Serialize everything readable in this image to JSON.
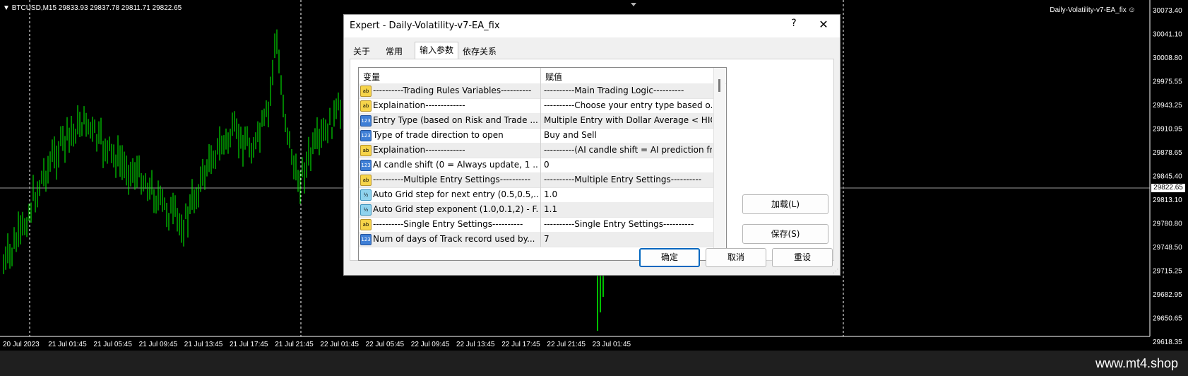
{
  "chart": {
    "symbol_info": "BTCUSD,M15  29833.93 29837.78 29811.71 29822.65",
    "ea_name": "Daily-Volatility-v7-EA_fix",
    "smile_glyph": "☺",
    "current_price": "29822.65",
    "price_labels": [
      "30073.40",
      "30041.10",
      "30008.80",
      "29975.55",
      "29943.25",
      "29910.95",
      "29878.65",
      "29845.40",
      "29813.10",
      "29780.80",
      "29748.50",
      "29715.25",
      "29682.95",
      "29650.65",
      "29618.35"
    ],
    "time_labels": [
      "20 Jul 2023",
      "21 Jul 01:45",
      "21 Jul 05:45",
      "21 Jul 09:45",
      "21 Jul 13:45",
      "21 Jul 17:45",
      "21 Jul 21:45",
      "22 Jul 01:45",
      "22 Jul 05:45",
      "22 Jul 09:45",
      "22 Jul 13:45",
      "22 Jul 17:45",
      "22 Jul 21:45",
      "23 Jul 01:45"
    ],
    "candle_color": "#00ff00"
  },
  "dialog": {
    "title": "Expert - Daily-Volatility-v7-EA_fix",
    "help": "?",
    "close": "✕",
    "tabs": [
      "关于",
      "常用",
      "输入参数",
      "依存关系"
    ],
    "grid": {
      "col_variable": "变量",
      "col_value": "赋值",
      "rows": [
        {
          "icon": "ab",
          "variable": "----------Trading Rules Variables----------",
          "value": "----------Main Trading Logic----------"
        },
        {
          "icon": "ab",
          "variable": "Explaination-------------",
          "value": "----------Choose your entry type based o..."
        },
        {
          "icon": "123",
          "variable": "Entry Type (based on Risk and Trade ...",
          "value": "Multiple Entry with Dollar Average < HIG..."
        },
        {
          "icon": "123",
          "variable": "Type of trade direction to open",
          "value": "Buy and Sell"
        },
        {
          "icon": "ab",
          "variable": "Explaination-------------",
          "value": "----------(AI candle shift = AI prediction fr..."
        },
        {
          "icon": "123",
          "variable": "AI candle shift (0 = Always update, 1 ...",
          "value": "0"
        },
        {
          "icon": "ab",
          "variable": "----------Multiple Entry Settings----------",
          "value": "----------Multiple Entry Settings----------"
        },
        {
          "icon": "v12",
          "variable": "Auto Grid step for next entry (0.5,0.5,...",
          "value": "1.0"
        },
        {
          "icon": "v12",
          "variable": "Auto Grid step exponent (1.0,0.1,2) - F...",
          "value": "1.1"
        },
        {
          "icon": "ab",
          "variable": "----------Single Entry Settings----------",
          "value": "----------Single Entry Settings----------"
        },
        {
          "icon": "123",
          "variable": "Num of days of Track record used by...",
          "value": "7"
        }
      ]
    },
    "buttons": {
      "load": "加载(L)",
      "save": "保存(S)",
      "ok": "确定",
      "cancel": "取消",
      "reset": "重设"
    }
  },
  "footer": {
    "brand": "www.mt4.shop"
  }
}
